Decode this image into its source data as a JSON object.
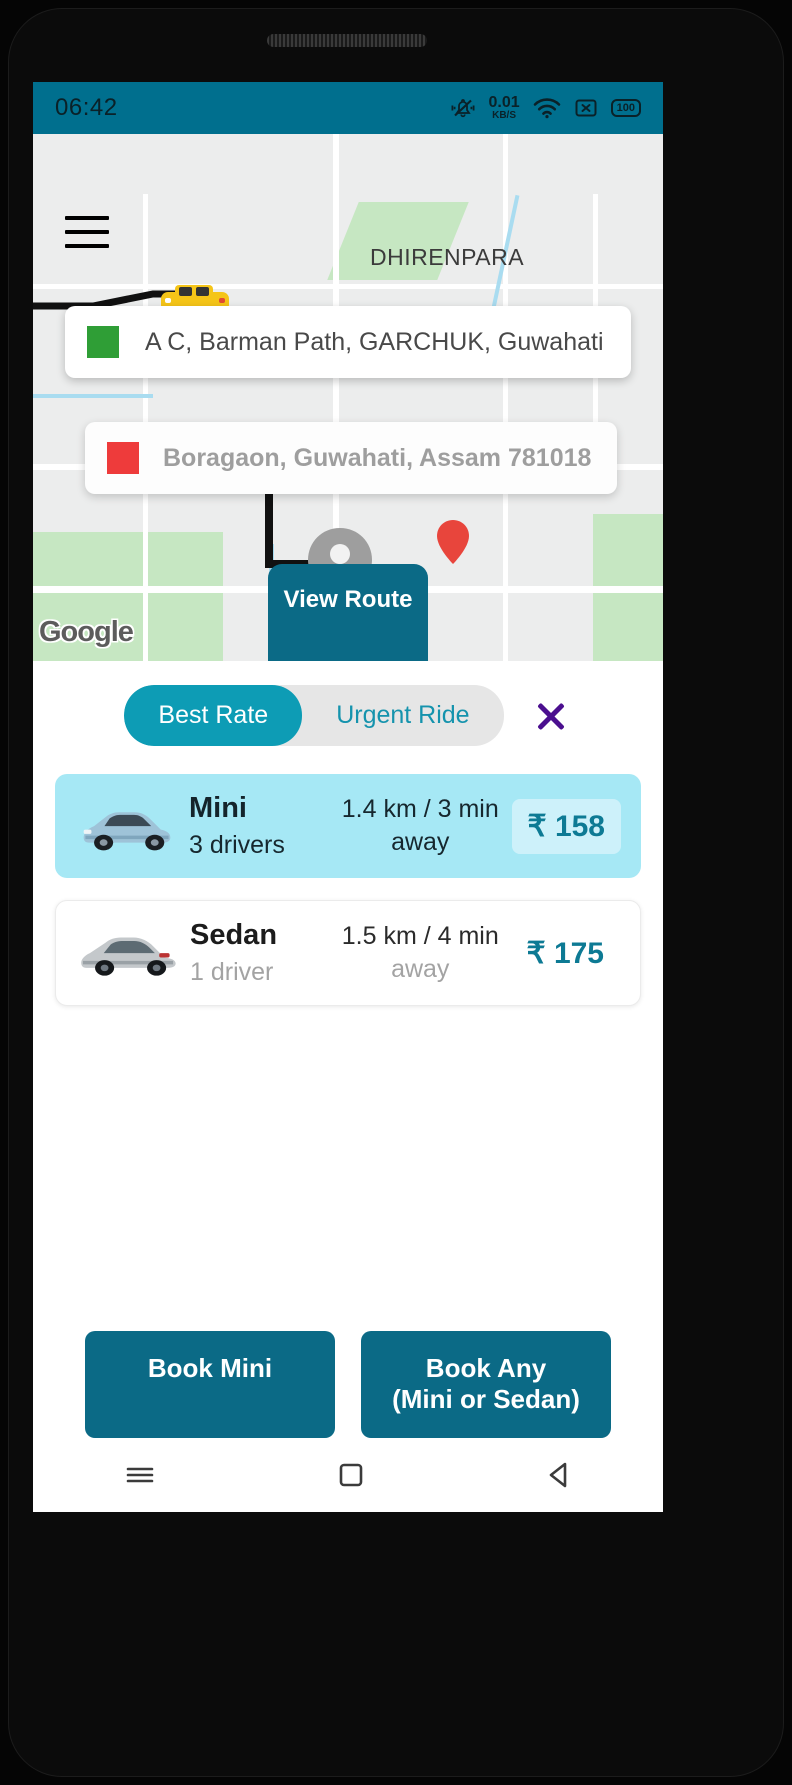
{
  "status_bar": {
    "time": "06:42",
    "net_speed_value": "0.01",
    "net_speed_unit": "KB/S",
    "battery": "100",
    "icons": [
      "silent-bell-icon",
      "wifi-icon",
      "x-box-icon",
      "battery-icon"
    ]
  },
  "map": {
    "labels": {
      "dhirenpara": "DHIRENPARA",
      "garchuk": "GARCHUK"
    },
    "attribution": "Google",
    "view_route_label": "View Route",
    "pickup": {
      "text": "A C, Barman Path, GARCHUK, Guwahati",
      "marker_color": "#2f9e36"
    },
    "destination": {
      "text": "Boragaon, Guwahati, Assam 781018",
      "marker_color": "#ee3b3b"
    }
  },
  "sheet": {
    "modes": [
      {
        "label": "Best Rate",
        "active": true
      },
      {
        "label": "Urgent Ride",
        "active": false
      }
    ],
    "close_label": "×",
    "rides": [
      {
        "name": "Mini",
        "drivers": "3 drivers",
        "eta": "1.4 km / 3 min",
        "eta_suffix": "away",
        "price": "₹ 158",
        "selected": true,
        "car_icon": "blue-hatchback-car-icon"
      },
      {
        "name": "Sedan",
        "drivers": "1 driver",
        "eta": "1.5 km / 4 min",
        "eta_suffix": "away",
        "price": "₹ 175",
        "selected": false,
        "car_icon": "silver-sedan-car-icon"
      }
    ],
    "book_buttons": [
      {
        "line1": "Book Mini",
        "line2": ""
      },
      {
        "line1": "Book Any",
        "line2": "(Mini or Sedan)"
      }
    ]
  },
  "nav_bar": {
    "recents": "recents-icon",
    "home": "home-icon",
    "back": "back-icon"
  },
  "colors": {
    "status_bar_bg": "#006f8e",
    "primary": "#0b6a86",
    "accent_teal": "#0d9cb5",
    "selected_card": "#a6e8f5",
    "price_text": "#0d7a94",
    "close_purple": "#4b0f8f"
  }
}
